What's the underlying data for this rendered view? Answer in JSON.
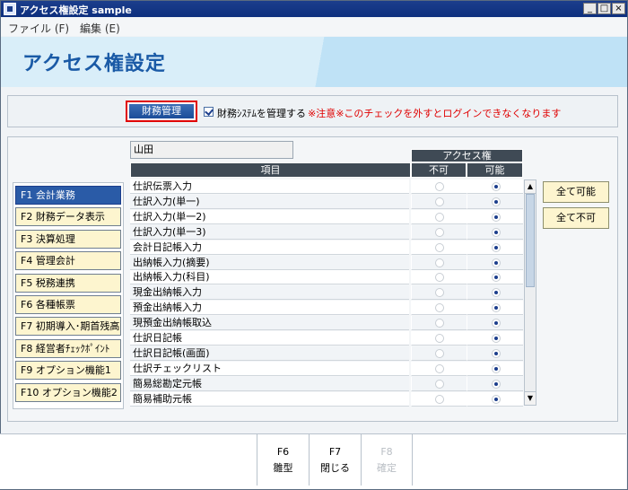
{
  "window": {
    "title": "アクセス権設定 sample",
    "controls": [
      "_",
      "□",
      "×"
    ]
  },
  "menu": [
    {
      "label": "ファイル (F)"
    },
    {
      "label": "編集 (E)"
    }
  ],
  "page_title": "アクセス権設定",
  "top": {
    "zaimu_button": "財務管理",
    "checkbox_label": "財務ｼｽﾃﾑを管理する",
    "checkbox_checked": true,
    "warning": "※注意※このチェックを外すとログインできなくなります"
  },
  "nav": [
    {
      "label": "F1 会計業務",
      "active": true
    },
    {
      "label": "F2 財務データ表示",
      "active": false
    },
    {
      "label": "F3 決算処理",
      "active": false
    },
    {
      "label": "F4 管理会計",
      "active": false
    },
    {
      "label": "F5 税務連携",
      "active": false
    },
    {
      "label": "F6 各種帳票",
      "active": false
    },
    {
      "label": "F7 初期導入･期首残高",
      "active": false
    },
    {
      "label": "F8 経営者ﾁｪｯｸﾎﾟｲﾝﾄ",
      "active": false
    },
    {
      "label": "F9 オプション機能1",
      "active": false
    },
    {
      "label": "F10 オプション機能2",
      "active": false
    }
  ],
  "user_name": "山田",
  "table": {
    "group_header": "アクセス権",
    "col_item": "項目",
    "col_no": "不可",
    "col_yes": "可能",
    "rows": [
      {
        "item": "仕訳伝票入力",
        "allowed": true
      },
      {
        "item": "仕訳入力(単一)",
        "allowed": true
      },
      {
        "item": "仕訳入力(単一2)",
        "allowed": true
      },
      {
        "item": "仕訳入力(単一3)",
        "allowed": true
      },
      {
        "item": "会計日記帳入力",
        "allowed": true
      },
      {
        "item": "出納帳入力(摘要)",
        "allowed": true
      },
      {
        "item": "出納帳入力(科目)",
        "allowed": true
      },
      {
        "item": "現金出納帳入力",
        "allowed": true
      },
      {
        "item": "預金出納帳入力",
        "allowed": true
      },
      {
        "item": "現預金出納帳取込",
        "allowed": true
      },
      {
        "item": "仕訳日記帳",
        "allowed": true
      },
      {
        "item": "仕訳日記帳(画面)",
        "allowed": true
      },
      {
        "item": "仕訳チェックリスト",
        "allowed": true
      },
      {
        "item": "簡易総勘定元帳",
        "allowed": true
      },
      {
        "item": "簡易補助元帳",
        "allowed": true
      }
    ]
  },
  "side_buttons": {
    "all_yes": "全て可能",
    "all_no": "全て不可"
  },
  "fkeys": [
    {
      "key": "F6",
      "label": "雛型",
      "enabled": true
    },
    {
      "key": "F7",
      "label": "閉じる",
      "enabled": true
    },
    {
      "key": "F8",
      "label": "確定",
      "enabled": false
    }
  ]
}
